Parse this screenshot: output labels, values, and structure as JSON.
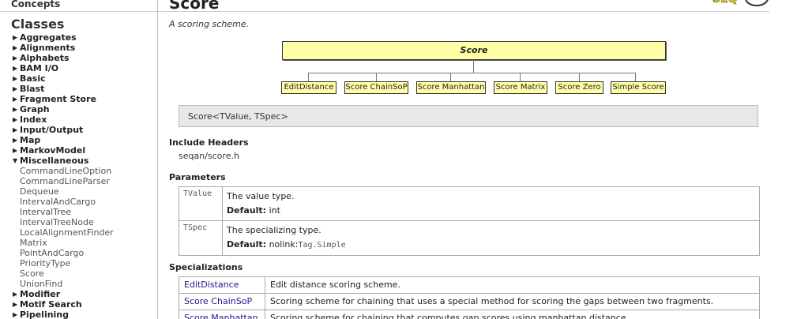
{
  "sidebar": {
    "concepts": "Concepts",
    "classes": "Classes",
    "items": [
      {
        "label": "Aggregates",
        "type": "group"
      },
      {
        "label": "Alignments",
        "type": "group"
      },
      {
        "label": "Alphabets",
        "type": "group"
      },
      {
        "label": "BAM I/O",
        "type": "group"
      },
      {
        "label": "Basic",
        "type": "group"
      },
      {
        "label": "Blast",
        "type": "group"
      },
      {
        "label": "Fragment Store",
        "type": "group"
      },
      {
        "label": "Graph",
        "type": "group"
      },
      {
        "label": "Index",
        "type": "group"
      },
      {
        "label": "Input/Output",
        "type": "group"
      },
      {
        "label": "Map",
        "type": "group"
      },
      {
        "label": "MarkovModel",
        "type": "group"
      },
      {
        "label": "Miscellaneous",
        "type": "group-open"
      },
      {
        "label": "CommandLineOption",
        "type": "sub"
      },
      {
        "label": "CommandLineParser",
        "type": "sub"
      },
      {
        "label": "Dequeue",
        "type": "sub"
      },
      {
        "label": "IntervalAndCargo",
        "type": "sub"
      },
      {
        "label": "IntervalTree",
        "type": "sub"
      },
      {
        "label": "IntervalTreeNode",
        "type": "sub"
      },
      {
        "label": "LocalAlignmentFinder",
        "type": "sub"
      },
      {
        "label": "Matrix",
        "type": "sub"
      },
      {
        "label": "PointAndCargo",
        "type": "sub"
      },
      {
        "label": "PriorityType",
        "type": "sub"
      },
      {
        "label": "Score",
        "type": "sub"
      },
      {
        "label": "UnionFind",
        "type": "sub"
      },
      {
        "label": "Modifier",
        "type": "group"
      },
      {
        "label": "Motif Search",
        "type": "group"
      },
      {
        "label": "Pipelining",
        "type": "group"
      }
    ]
  },
  "main": {
    "title": "Score",
    "subtitle": "A scoring scheme.",
    "diagram": {
      "root": "Score",
      "children": [
        "EditDistance",
        "Score ChainSoP",
        "Score Manhattan",
        "Score Matrix",
        "Score Zero",
        "Simple Score"
      ]
    },
    "signature": "Score<TValue, TSpec>",
    "include_headers_heading": "Include Headers",
    "include_header_file": "seqan/score.h",
    "parameters_heading": "Parameters",
    "default_label": "Default:",
    "parameters": [
      {
        "name": "TValue",
        "desc": "The value type.",
        "default": "int",
        "default_mono": ""
      },
      {
        "name": "TSpec",
        "desc": "The specializing type.",
        "default": "nolink:",
        "default_mono": "Tag.Simple"
      }
    ],
    "specializations_heading": "Specializations",
    "specializations": [
      {
        "name": "EditDistance",
        "desc": "Edit distance scoring scheme."
      },
      {
        "name": "Score ChainSoP",
        "desc": "Scoring scheme for chaining that uses a special method for scoring the gaps between two fragments."
      },
      {
        "name": "Score Manhattan",
        "desc": "Scoring scheme for chaining that computes gap scores using manhattan distance."
      }
    ]
  }
}
